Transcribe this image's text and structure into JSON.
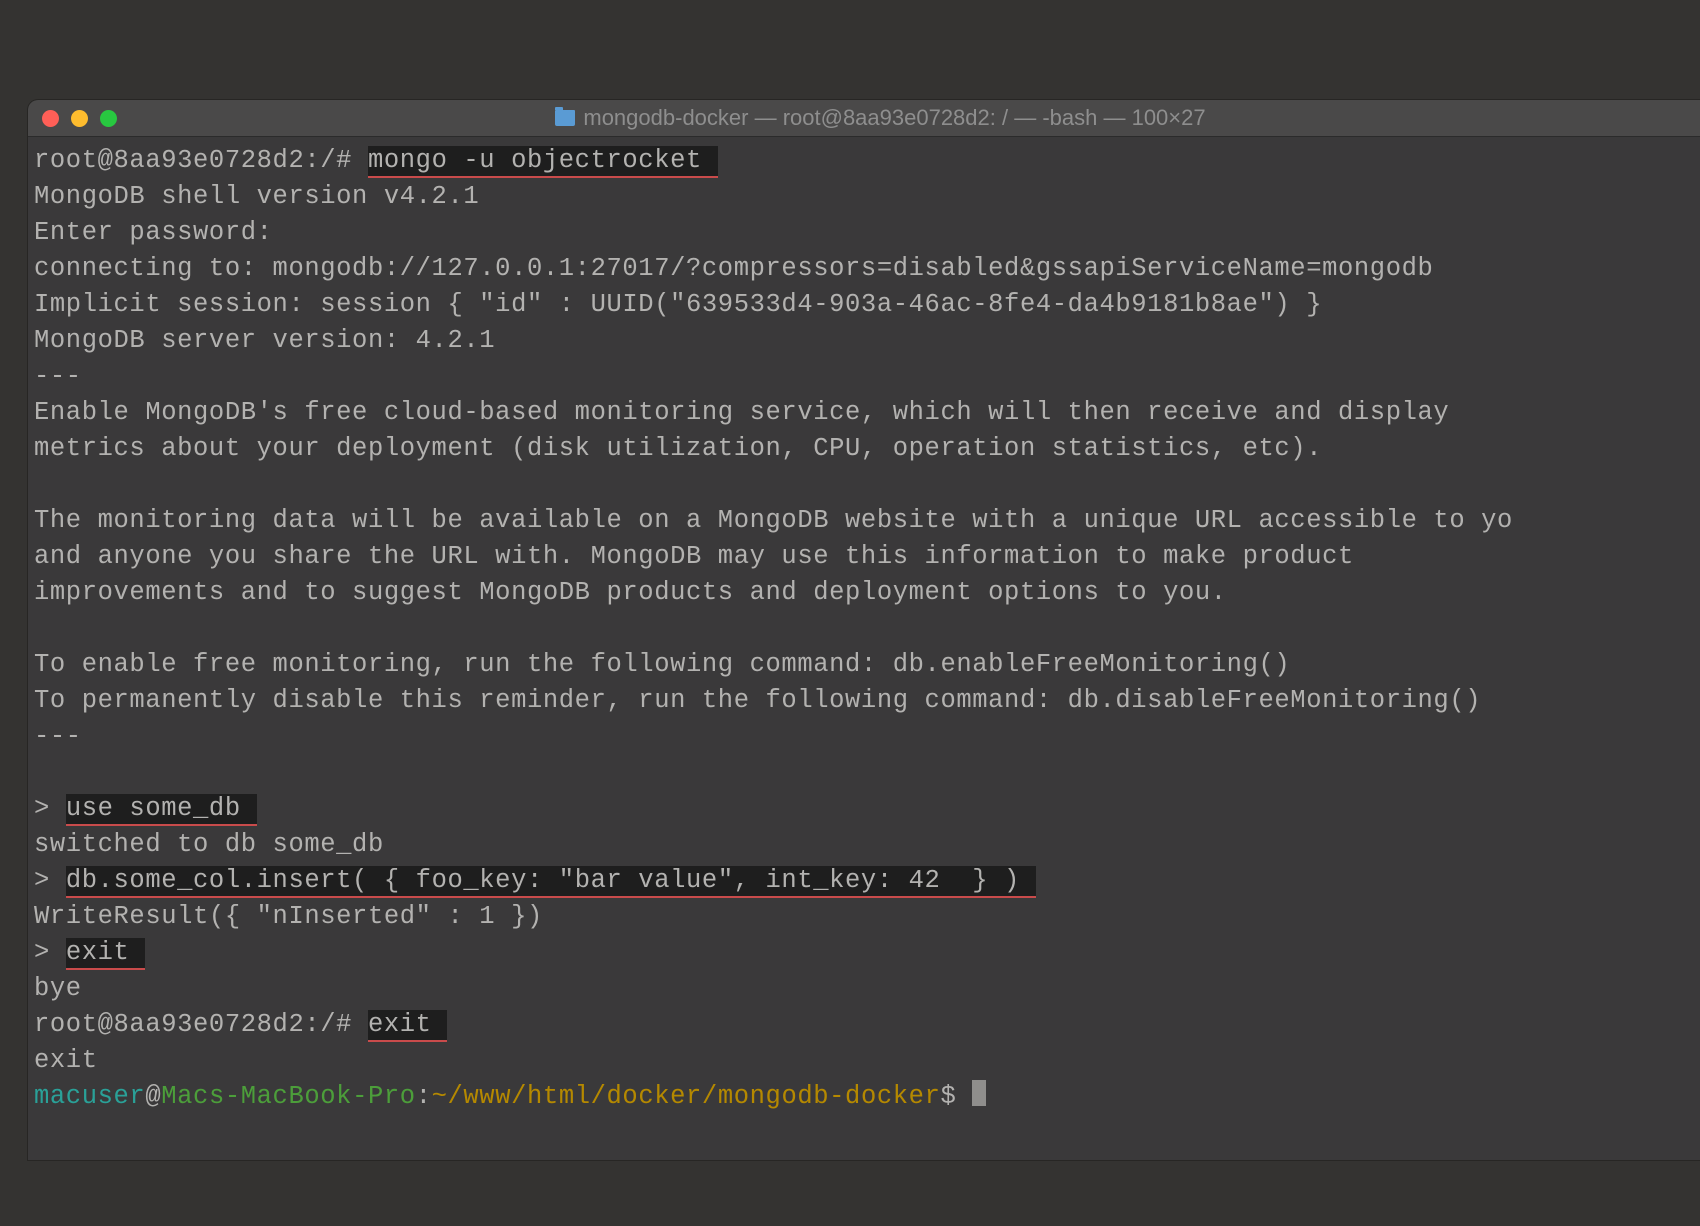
{
  "titlebar": {
    "title": "mongodb-docker — root@8aa93e0728d2: / — -bash — 100×27"
  },
  "l1": {
    "prompt": "root@8aa93e0728d2:/# ",
    "cmd": "mongo -u objectrocket "
  },
  "l2": "MongoDB shell version v4.2.1",
  "l3": "Enter password:",
  "l4": "connecting to: mongodb://127.0.0.1:27017/?compressors=disabled&gssapiServiceName=mongodb",
  "l5": "Implicit session: session { \"id\" : UUID(\"639533d4-903a-46ac-8fe4-da4b9181b8ae\") }",
  "l6": "MongoDB server version: 4.2.1",
  "l7": "---",
  "l8": "Enable MongoDB's free cloud-based monitoring service, which will then receive and display",
  "l9": "metrics about your deployment (disk utilization, CPU, operation statistics, etc).",
  "l10": "",
  "l11": "The monitoring data will be available on a MongoDB website with a unique URL accessible to yo",
  "l12": "and anyone you share the URL with. MongoDB may use this information to make product",
  "l13": "improvements and to suggest MongoDB products and deployment options to you.",
  "l14": "",
  "l15": "To enable free monitoring, run the following command: db.enableFreeMonitoring()",
  "l16": "To permanently disable this reminder, run the following command: db.disableFreeMonitoring()",
  "l17": "---",
  "l18": "",
  "use": {
    "prompt": "> ",
    "cmd": "use some_db "
  },
  "l20": "switched to db some_db",
  "ins": {
    "prompt": "> ",
    "cmd": "db.some_col.insert( { foo_key: \"bar value\", int_key: 42  } ) "
  },
  "l22": "WriteResult({ \"nInserted\" : 1 })",
  "exit1": {
    "prompt": "> ",
    "cmd": "exit "
  },
  "l24": "bye",
  "exit2": {
    "prompt": "root@8aa93e0728d2:/# ",
    "cmd": "exit "
  },
  "l26": "exit",
  "final": {
    "user": "macuser",
    "at": "@",
    "host": "Macs-MacBook-Pro",
    "colon": ":",
    "path": "~/www/html/docker/mongodb-docker",
    "dollar": "$ "
  }
}
